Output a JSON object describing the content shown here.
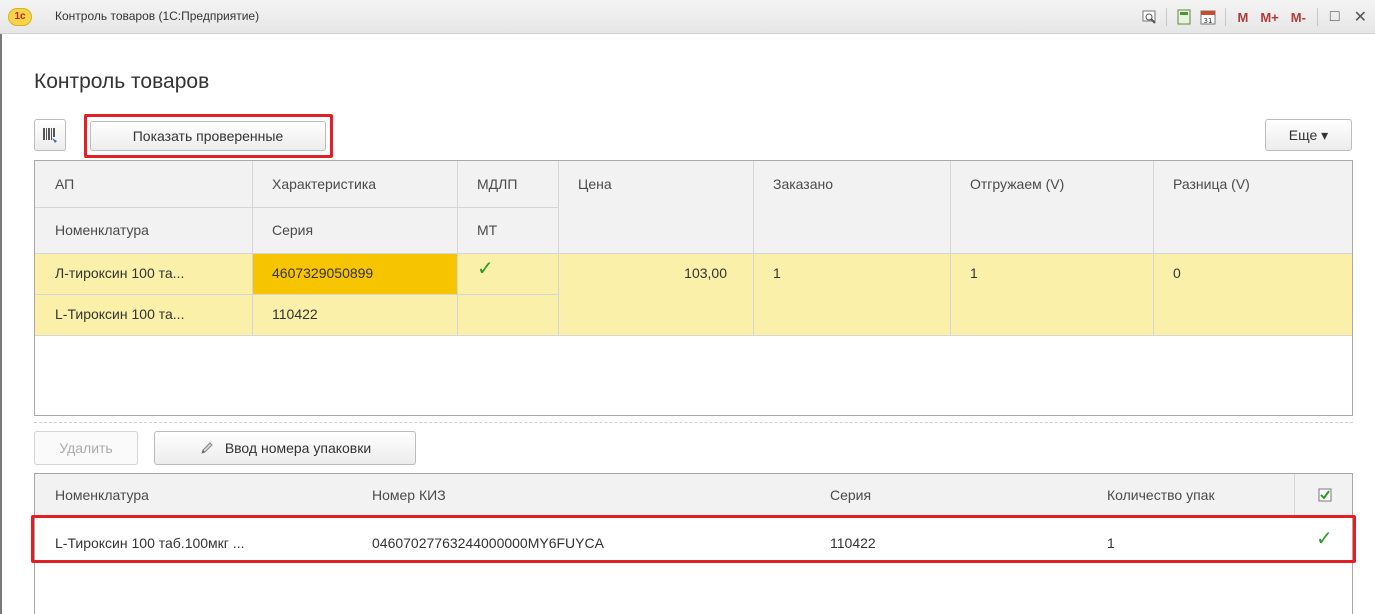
{
  "window": {
    "title": "Контроль товаров  (1С:Предприятие)",
    "logo_text": "1c",
    "toolbar": {
      "m": "M",
      "m_plus": "M+",
      "m_minus": "M-",
      "restore": "□",
      "close": "✕"
    }
  },
  "page_title": "Контроль товаров",
  "command_bar": {
    "scan_icon": "barcode-scanner-icon",
    "show_checked_label": "Показать проверенные",
    "more_label": "Еще ▾"
  },
  "goods_table": {
    "headers_row1": [
      "АП",
      "Характеристика",
      "МДЛП",
      "Цена",
      "Заказано",
      "Отгружаем (V)",
      "Разница (V)"
    ],
    "headers_row2": [
      "Номенклатура",
      "Серия",
      "МТ"
    ],
    "row": {
      "ap": "Л-тироксин 100 та...",
      "characteristic": "4607329050899",
      "mdlp": "✓",
      "price": "103,00",
      "ordered": "1",
      "shipping": "1",
      "difference": "0",
      "nomenclature": "L-Тироксин 100 та...",
      "series": "110422"
    }
  },
  "lower_bar": {
    "delete_label": "Удалить",
    "pack_label": "Ввод номера упаковки",
    "pack_icon": "pencil-icon"
  },
  "kiz_table": {
    "headers": [
      "Номенклатура",
      "Номер КИЗ",
      "Серия",
      "Количество упак",
      "checked-icon"
    ],
    "row": {
      "nomenclature": "L-Тироксин 100 таб.100мкг ...",
      "kiz": "04607027763244000000MY6FUYCA",
      "series": "110422",
      "quantity": "1",
      "checked": "✓"
    }
  },
  "colors": {
    "highlight": "#e31e24",
    "row_yellow": "#faf0aa",
    "selected_cell": "#f6c400",
    "check_green": "#2a9a2a"
  }
}
